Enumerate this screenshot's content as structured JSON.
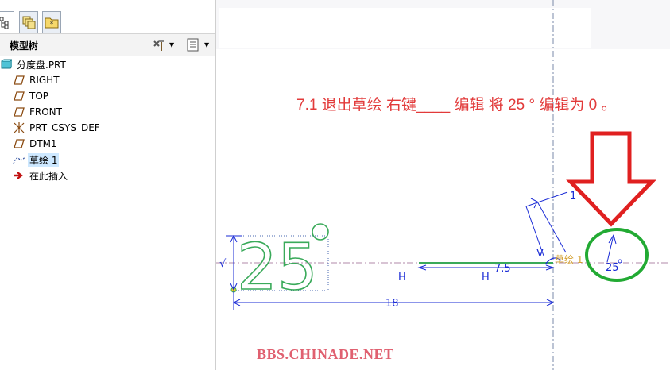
{
  "tabs": [
    {
      "icon": "model-tree-icon",
      "active": true
    },
    {
      "icon": "layer-tree-icon",
      "active": false
    },
    {
      "icon": "favorites-folder-icon",
      "active": false
    }
  ],
  "panel": {
    "title": "模型树",
    "tools_icon": "tree-settings-icon",
    "columns_icon": "tree-columns-icon"
  },
  "tree": {
    "root": {
      "label": "分度盘.PRT",
      "icon": "part-icon"
    },
    "items": [
      {
        "label": "RIGHT",
        "icon": "datum-plane-icon",
        "selected": false
      },
      {
        "label": "TOP",
        "icon": "datum-plane-icon",
        "selected": false
      },
      {
        "label": "FRONT",
        "icon": "datum-plane-icon",
        "selected": false
      },
      {
        "label": "PRT_CSYS_DEF",
        "icon": "coordinate-system-icon",
        "selected": false
      },
      {
        "label": "DTM1",
        "icon": "datum-plane-icon",
        "selected": false
      },
      {
        "label": "草绘 1",
        "icon": "sketch-icon",
        "selected": true
      },
      {
        "label": "在此插入",
        "icon": "insert-here-arrow-icon",
        "selected": false
      }
    ]
  },
  "canvas": {
    "note": "7.1 退出草绘   右键____ 编辑    将 25 ° 编辑为 0 。",
    "sketch_text": "25°",
    "dims": {
      "left_vertical": "√",
      "h_left": "H",
      "h_mid": "H",
      "dist_7_5": "7.5",
      "dist_18": "18",
      "top_1": "1",
      "v_mark": "V",
      "angle_25": "25",
      "sketch_label": "草绘 1"
    },
    "watermark": "BBS.CHINADE.NET"
  },
  "colors": {
    "note_red": "#e23a3a",
    "dimension_blue": "#1a2bd6",
    "sketch_green": "#3aaa5a",
    "highlight_circle": "#22aa33",
    "arrow_red": "#e02020",
    "watermark": "#e06070",
    "selection": "#cde8ff"
  }
}
